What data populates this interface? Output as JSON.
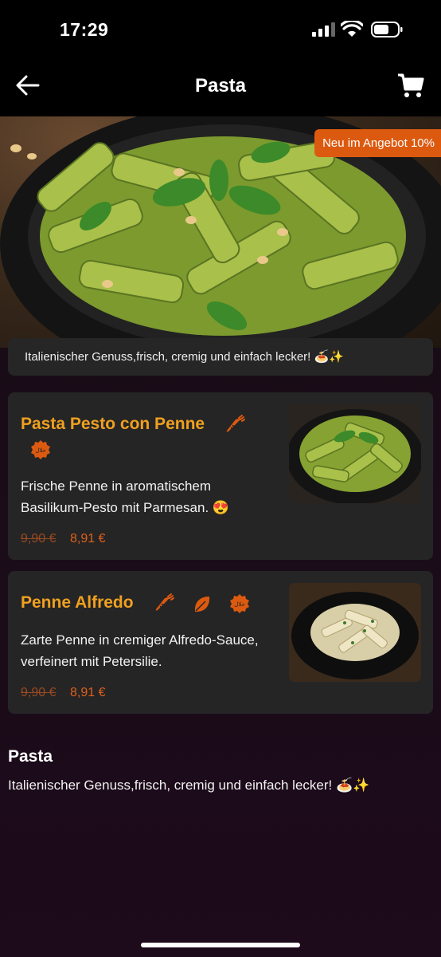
{
  "status_bar": {
    "time": "17:29"
  },
  "header": {
    "title": "Pasta",
    "back_icon": "arrow-left-icon",
    "cart_icon": "shopping-cart-icon"
  },
  "hero": {
    "badge": "Neu im Angebot 10%",
    "tagline": "Italienischer Genuss,frisch, cremig und einfach lecker! 🍝✨"
  },
  "items": [
    {
      "name": "Pasta Pesto con Penne",
      "description": "Frische Penne in aromatischem Basilikum-Pesto mit Parmesan. 😍",
      "old_price": "9,90 €",
      "new_price": "8,91 €",
      "icons": [
        "carrot-icon",
        "halal-icon"
      ]
    },
    {
      "name": "Penne Alfredo",
      "description": "Zarte Penne in cremiger Alfredo-Sauce, verfeinert mit Petersilie.",
      "old_price": "9,90 €",
      "new_price": "8,91 €",
      "icons": [
        "carrot-icon",
        "leaf-icon",
        "halal-icon"
      ]
    }
  ],
  "section": {
    "title": "Pasta",
    "description": "Italienischer Genuss,frisch, cremig und einfach lecker! 🍝✨"
  },
  "colors": {
    "accent": "#dc5a10",
    "title": "#f0a020",
    "card": "#252525"
  }
}
